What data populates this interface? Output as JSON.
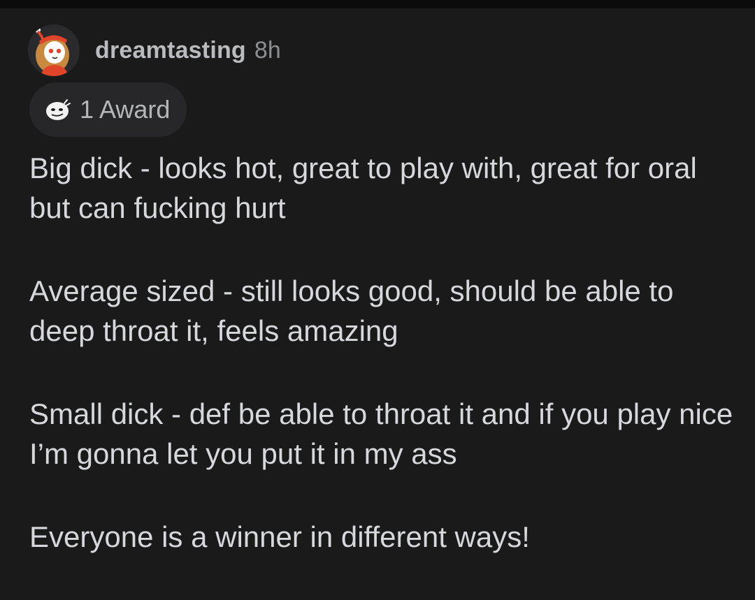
{
  "comment": {
    "author": "dreamtasting",
    "time": "8h",
    "award_label": "1 Award",
    "paragraphs": [
      "Big dick - looks hot, great to play with, great for oral but can fucking hurt",
      "Average sized - still looks good, should be able to deep throat it, feels amazing",
      "Small dick - def be able to throat it and if you play nice I’m gonna let you put it in my ass",
      "Everyone is a winner in different ways!"
    ]
  },
  "icons": {
    "avatar": "user-avatar",
    "award": "award-icon"
  },
  "colors": {
    "background": "#1a1a1b",
    "text": "#d7d8dc",
    "username": "#b9bbbe",
    "meta": "#8d8f93",
    "award_pill": "#272729"
  }
}
